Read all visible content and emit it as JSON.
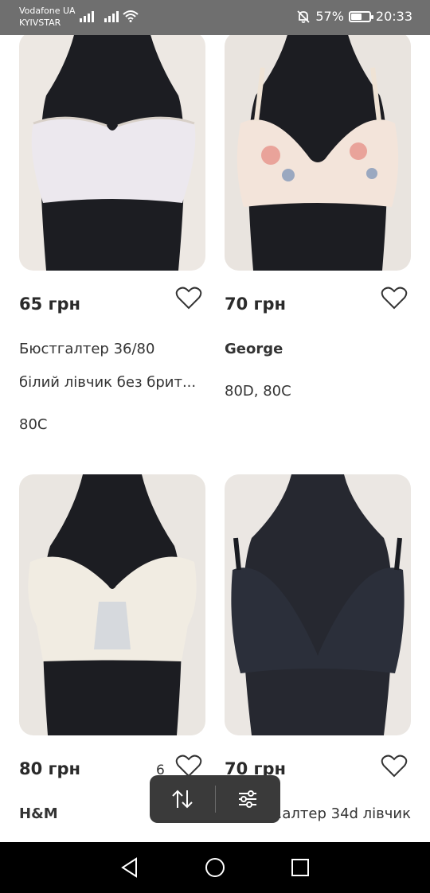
{
  "status_bar": {
    "carrier_1": "Vodafone UA",
    "carrier_2": "KYIVSTAR",
    "battery_percent": "57%",
    "battery_level": 0.57,
    "time": "20:33"
  },
  "listings": [
    {
      "price": "65 грн",
      "title_line_1": "Бюстгалтер 36/80",
      "title_line_2": "білий лівчик без брит...",
      "size": "80C",
      "bra_color": "#ece8ee"
    },
    {
      "price": "70 грн",
      "title_line_1": "George",
      "title_line_2": "",
      "size": "80D, 80C",
      "bra_color": "#f3e4da"
    },
    {
      "price": "80 грн",
      "price_extra": "6",
      "title_line_1": "H&M",
      "bra_color": "#f1ece2"
    },
    {
      "price": "70 грн",
      "title_line_1": "...алтер 34d лівчик",
      "bra_color": "#2b2f3a"
    }
  ],
  "icons": {
    "favorite": "heart-outline-icon",
    "sort": "sort-arrows-icon",
    "filter": "filter-sliders-icon",
    "back": "nav-back-icon",
    "home": "nav-home-icon",
    "recents": "nav-recents-icon"
  },
  "colors": {
    "status_bar_bg": "#6f6f6f",
    "pill_bg": "#3a3a3a",
    "nav_bg": "#000000"
  }
}
